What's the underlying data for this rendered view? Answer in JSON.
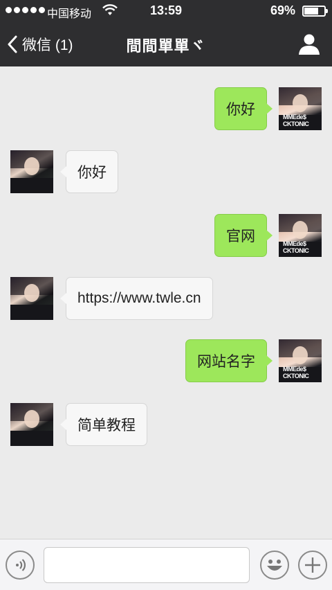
{
  "status_bar": {
    "carrier": "中国移动",
    "time": "13:59",
    "battery_percent": "69%",
    "battery_level": 0.69,
    "signal_dots": 5
  },
  "nav": {
    "back_label": "微信 (1)",
    "title": "間間單單ヾ",
    "back_icon": "chevron-left-icon",
    "profile_icon": "user-icon"
  },
  "messages": [
    {
      "side": "out",
      "text": "你好"
    },
    {
      "side": "in",
      "text": "你好"
    },
    {
      "side": "out",
      "text": "官网"
    },
    {
      "side": "in",
      "text": "https://www.twle.cn"
    },
    {
      "side": "out",
      "text": "网站名字"
    },
    {
      "side": "in",
      "text": "简单教程"
    }
  ],
  "avatar_shirt_text": "MMEde$ CKTONIC",
  "input_bar": {
    "voice_icon": "voice-icon",
    "emoji_icon": "emoji-icon",
    "plus_icon": "plus-icon",
    "input_value": ""
  },
  "colors": {
    "nav_bg": "#2e2e30",
    "chat_bg": "#ebebeb",
    "bubble_out": "#9de75b",
    "bubble_in": "#f7f7f7"
  }
}
